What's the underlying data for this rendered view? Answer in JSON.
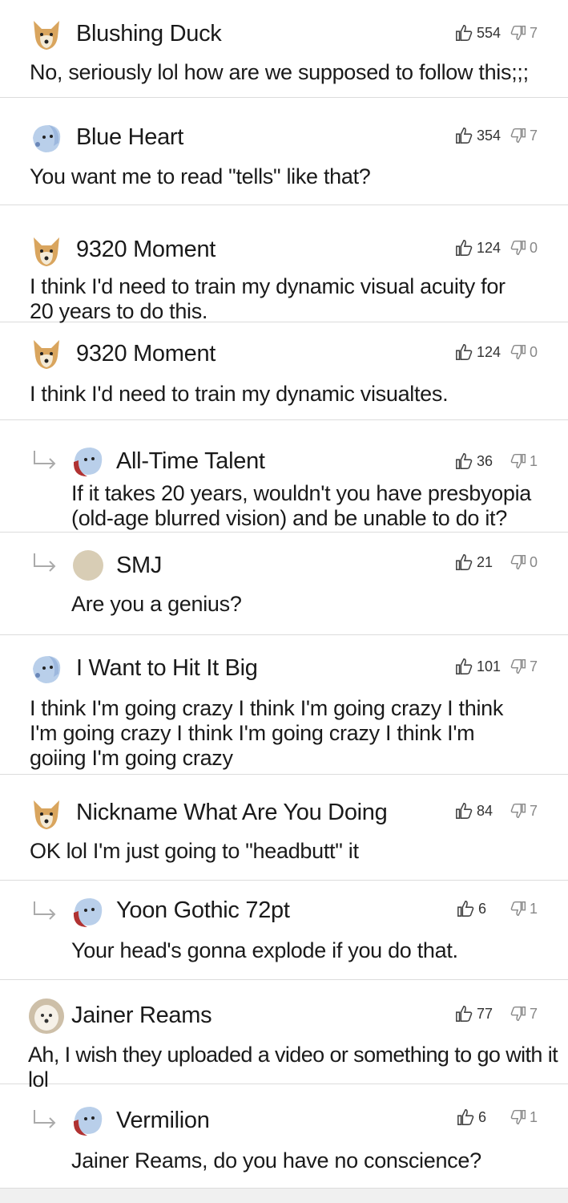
{
  "colors": {
    "divider": "#dcdcdc",
    "text": "#1a1a1a",
    "icon": "#555555"
  },
  "comments": [
    {
      "username": "Blushing Duck",
      "avatar": "dog-avatar-icon",
      "likes": "554",
      "dislikes": "7",
      "text": "No, seriously lol how are we supposed to follow this;;;"
    },
    {
      "username": "Blue Heart",
      "avatar": "blue-creature-avatar-icon",
      "likes": "354",
      "dislikes": "7",
      "text": "You want me to read \"tells\" like that?"
    },
    {
      "username": "9320 Moment",
      "avatar": "dog-avatar-icon",
      "likes": "124",
      "dislikes": "0",
      "text": "I think I'd need to train my dynamic visual acuity for 20 years to do this."
    },
    {
      "username": "9320 Moment",
      "avatar": "dog-avatar-icon",
      "likes": "124",
      "dislikes": "0",
      "text": "I think I'd need to train my dynamic visualtes."
    },
    {
      "username": "All-Time Talent",
      "avatar": "blue-creature-red-avatar-icon",
      "likes": "36",
      "dislikes": "1",
      "text": "If it takes 20 years, wouldn't you have presbyopia (old-age blurred vision) and be unable to do it?"
    },
    {
      "username": "SMJ",
      "avatar": "beige-circle-avatar-icon",
      "likes": "21",
      "dislikes": "0",
      "text": "Are you a genius?"
    },
    {
      "username": "I Want to Hit It Big",
      "avatar": "blue-creature-avatar-icon",
      "likes": "101",
      "dislikes": "7",
      "text": "I think I'm going crazy I think I'm going crazy I think I'm going crazy I think I'm going crazy I think I'm goiing I'm going crazy"
    },
    {
      "username": "Nickname What Are You Doing",
      "avatar": "dog-avatar-icon",
      "likes": "84",
      "dislikes": "7",
      "text": "OK lol I'm just going to \"headbutt\" it"
    },
    {
      "username": "Yoon Gothic 72pt",
      "avatar": "blue-creature-red-avatar-icon",
      "likes": "6",
      "dislikes": "1",
      "text": "Your head's gonna explode if you do that."
    },
    {
      "username": "Jainer Reams",
      "avatar": "puppy-photo-avatar-icon",
      "likes": "77",
      "dislikes": "7",
      "text": "Ah, I wish they uploaded a video or something to go with it lol"
    },
    {
      "username": "Vermilion",
      "avatar": "blue-creature-red-avatar-icon",
      "likes": "6",
      "dislikes": "1",
      "text": "Jainer Reams, do you have no conscience?"
    }
  ]
}
